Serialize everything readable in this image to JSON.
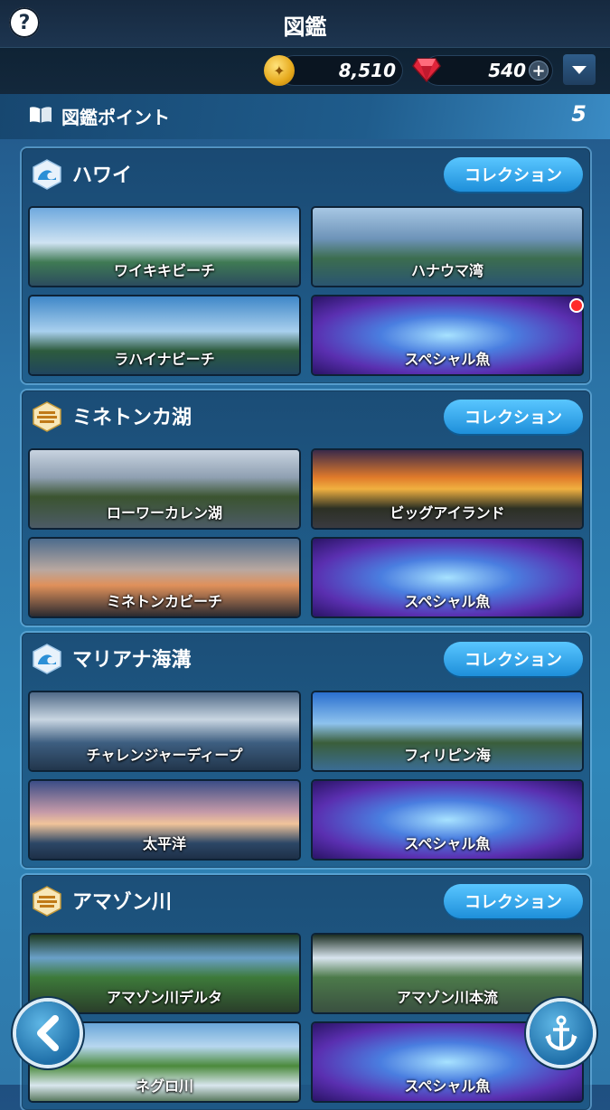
{
  "header": {
    "title": "図鑑",
    "help_label": "?"
  },
  "currency": {
    "coins": "8,510",
    "gems": "540",
    "plus": "+"
  },
  "points": {
    "label": "図鑑ポイント",
    "value": "5"
  },
  "collection_label": "コレクション",
  "regions": [
    {
      "name": "ハワイ",
      "icon": "ocean-wave-icon",
      "spots": [
        "ワイキキビーチ",
        "ハナウマ湾",
        "ラハイナビーチ",
        "スペシャル魚"
      ]
    },
    {
      "name": "ミネトンカ湖",
      "icon": "lake-icon",
      "spots": [
        "ローワーカレン湖",
        "ビッグアイランド",
        "ミネトンカビーチ",
        "スペシャル魚"
      ]
    },
    {
      "name": "マリアナ海溝",
      "icon": "ocean-wave-icon",
      "spots": [
        "チャレンジャーディープ",
        "フィリピン海",
        "太平洋",
        "スペシャル魚"
      ]
    },
    {
      "name": "アマゾン川",
      "icon": "lake-icon",
      "spots": [
        "アマゾン川デルタ",
        "アマゾン川本流",
        "ネグロ川",
        "スペシャル魚"
      ]
    }
  ],
  "colors": {
    "accent": "#2fa8f0",
    "coin": "#f2b52a",
    "gem": "#e0243a",
    "new_badge": "#ff2a2a"
  }
}
